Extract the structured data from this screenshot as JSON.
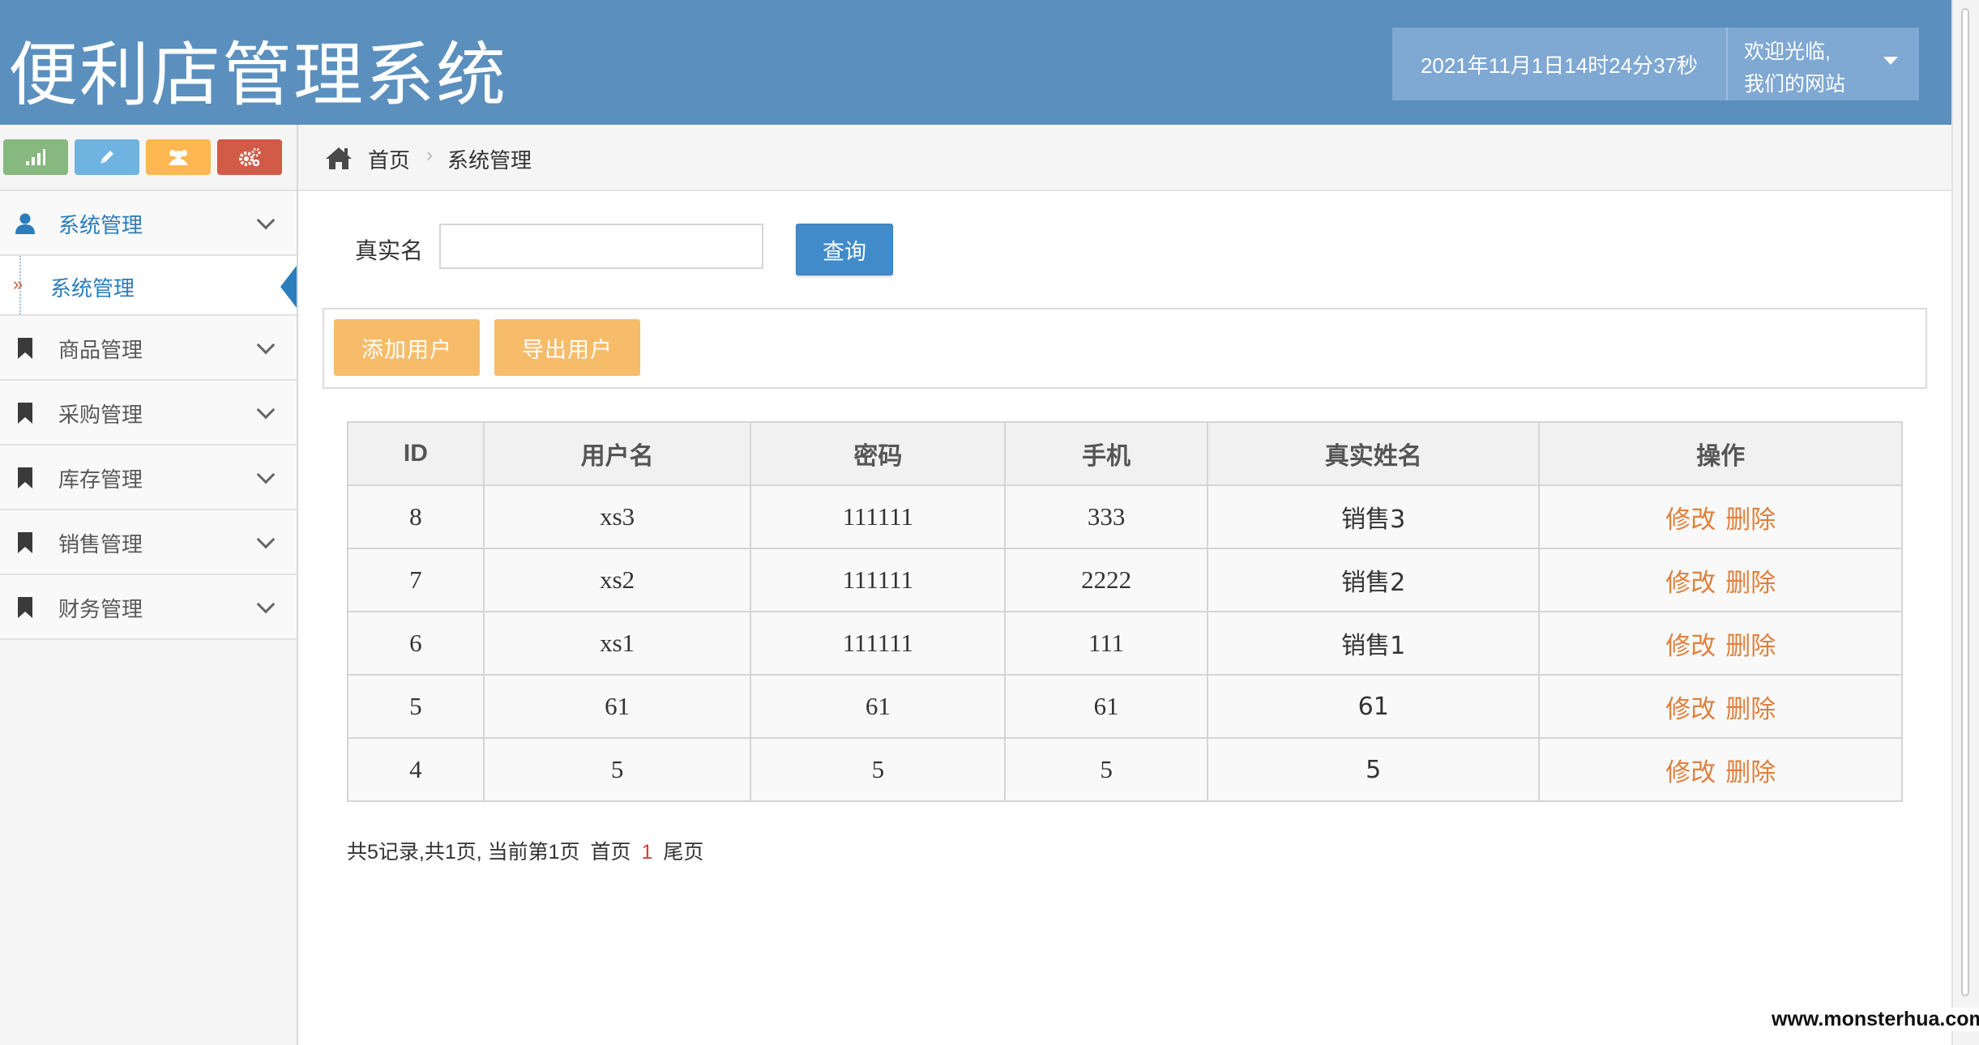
{
  "header": {
    "app_title": "便利店管理系统",
    "datetime": "2021年11月1日14时24分37秒",
    "welcome_line1": "欢迎光临,",
    "welcome_line2": "我们的网站"
  },
  "shortcuts": [
    {
      "icon": "signal-icon",
      "color": "#87b87f"
    },
    {
      "icon": "pencil-icon",
      "color": "#6fb3e0"
    },
    {
      "icon": "users-icon",
      "color": "#ffb752"
    },
    {
      "icon": "cogs-icon",
      "color": "#d15b47"
    }
  ],
  "sidebar": {
    "items": [
      {
        "label": "系统管理",
        "icon": "user-icon",
        "active": true
      },
      {
        "label": "商品管理",
        "icon": "bookmark-icon"
      },
      {
        "label": "采购管理",
        "icon": "bookmark-icon"
      },
      {
        "label": "库存管理",
        "icon": "bookmark-icon"
      },
      {
        "label": "销售管理",
        "icon": "bookmark-icon"
      },
      {
        "label": "财务管理",
        "icon": "bookmark-icon"
      }
    ],
    "submenu": {
      "label": "系统管理",
      "marker": "»"
    }
  },
  "breadcrumb": {
    "home": "首页",
    "separator": "›",
    "current": "系统管理"
  },
  "search": {
    "label": "真实名",
    "value": "",
    "button": "查询"
  },
  "toolbar": {
    "add_label": "添加用户",
    "export_label": "导出用户"
  },
  "table": {
    "headers": [
      "ID",
      "用户名",
      "密码",
      "手机",
      "真实姓名",
      "操作"
    ],
    "rows": [
      {
        "id": "8",
        "username": "xs3",
        "password": "111111",
        "phone": "333",
        "realname": "销售3"
      },
      {
        "id": "7",
        "username": "xs2",
        "password": "111111",
        "phone": "2222",
        "realname": "销售2"
      },
      {
        "id": "6",
        "username": "xs1",
        "password": "111111",
        "phone": "111",
        "realname": "销售1"
      },
      {
        "id": "5",
        "username": "61",
        "password": "61",
        "phone": "61",
        "realname": "61"
      },
      {
        "id": "4",
        "username": "5",
        "password": "5",
        "phone": "5",
        "realname": "5"
      }
    ],
    "edit_label": "修改",
    "delete_label": "删除"
  },
  "pagination": {
    "summary": "共5记录,共1页, 当前第1页",
    "first": "首页",
    "current": "1",
    "last": "尾页"
  },
  "watermark": "www.monsterhua.com",
  "colors": {
    "header_bg": "#5b8fbe",
    "primary": "#428bca",
    "warning": "#f7bc6a",
    "link_orange": "#e0803c",
    "active_blue": "#2b7dbc"
  }
}
